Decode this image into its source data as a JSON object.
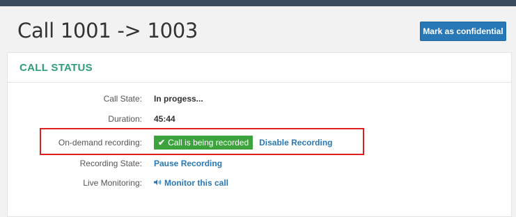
{
  "header": {
    "title": "Call 1001 -> 1003",
    "confidential_button": "Mark as confidential"
  },
  "panel": {
    "heading": "CALL STATUS",
    "rows": [
      {
        "label": "Call State:",
        "value": "In progess..."
      },
      {
        "label": "Duration:",
        "value": "45:44"
      },
      {
        "label": "On-demand recording:",
        "badge": "Call is being recorded",
        "action": "Disable Recording"
      },
      {
        "label": "Recording State:",
        "action": "Pause Recording"
      },
      {
        "label": "Live Monitoring:",
        "action": "Monitor this call",
        "icon": "speaker-icon"
      }
    ]
  },
  "colors": {
    "topbar": "#3a4a5c",
    "primary": "#2878b8",
    "heading": "#2e9e78",
    "badge": "#3da33d",
    "highlight": "#e02020"
  }
}
